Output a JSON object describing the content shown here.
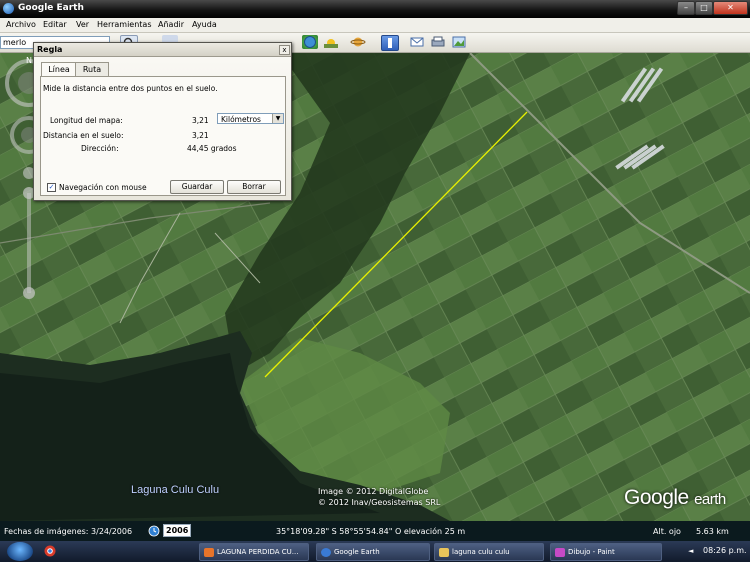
{
  "window": {
    "title": "Google Earth",
    "min": "–",
    "max": "□",
    "close": "✕"
  },
  "menu": [
    "Archivo",
    "Editar",
    "Ver",
    "Herramientas",
    "Añadir",
    "Ayuda"
  ],
  "search": {
    "value": "merlo"
  },
  "dialog": {
    "title": "Regla",
    "close": "x",
    "tabs": [
      "Línea",
      "Ruta"
    ],
    "description": "Mide la distancia entre dos puntos en el suelo.",
    "map_length_label": "Longitud del mapa:",
    "map_length_value": "3,21",
    "unit": "Kilómetros",
    "ground_distance_label": "Distancia en el suelo:",
    "ground_distance_value": "3,21",
    "direction_label": "Dirección:",
    "direction_value": "44,45 grados",
    "mouse_nav_label": "Navegación con mouse",
    "mouse_nav_checked": "✓",
    "save_button": "Guardar",
    "clear_button": "Borrar"
  },
  "map": {
    "lake_label": "Laguna Culu Culu",
    "copyright_1": "Image © 2012 DigitalGlobe",
    "copyright_2": "© 2012 Inav/Geosistemas SRL",
    "logo_main": "Google",
    "logo_sub": "earth",
    "compass_north": "N",
    "ruler_line_color": "#e8f000"
  },
  "status": {
    "imagery_date": "Fechas de imágenes: 3/24/2006",
    "year": "2006",
    "coordinates": "35°18'09.28\" S  58°55'54.84\" O elevación   25 m",
    "eye_alt_label": "Alt. ojo",
    "eye_alt_value": "5.63 km"
  },
  "taskbar": {
    "items": [
      "LAGUNA PERDIDA CU...",
      "Google Earth",
      "laguna culu culu",
      "Dibujo - Paint"
    ],
    "clock": "08:26 p.m.",
    "tray": "◄"
  }
}
